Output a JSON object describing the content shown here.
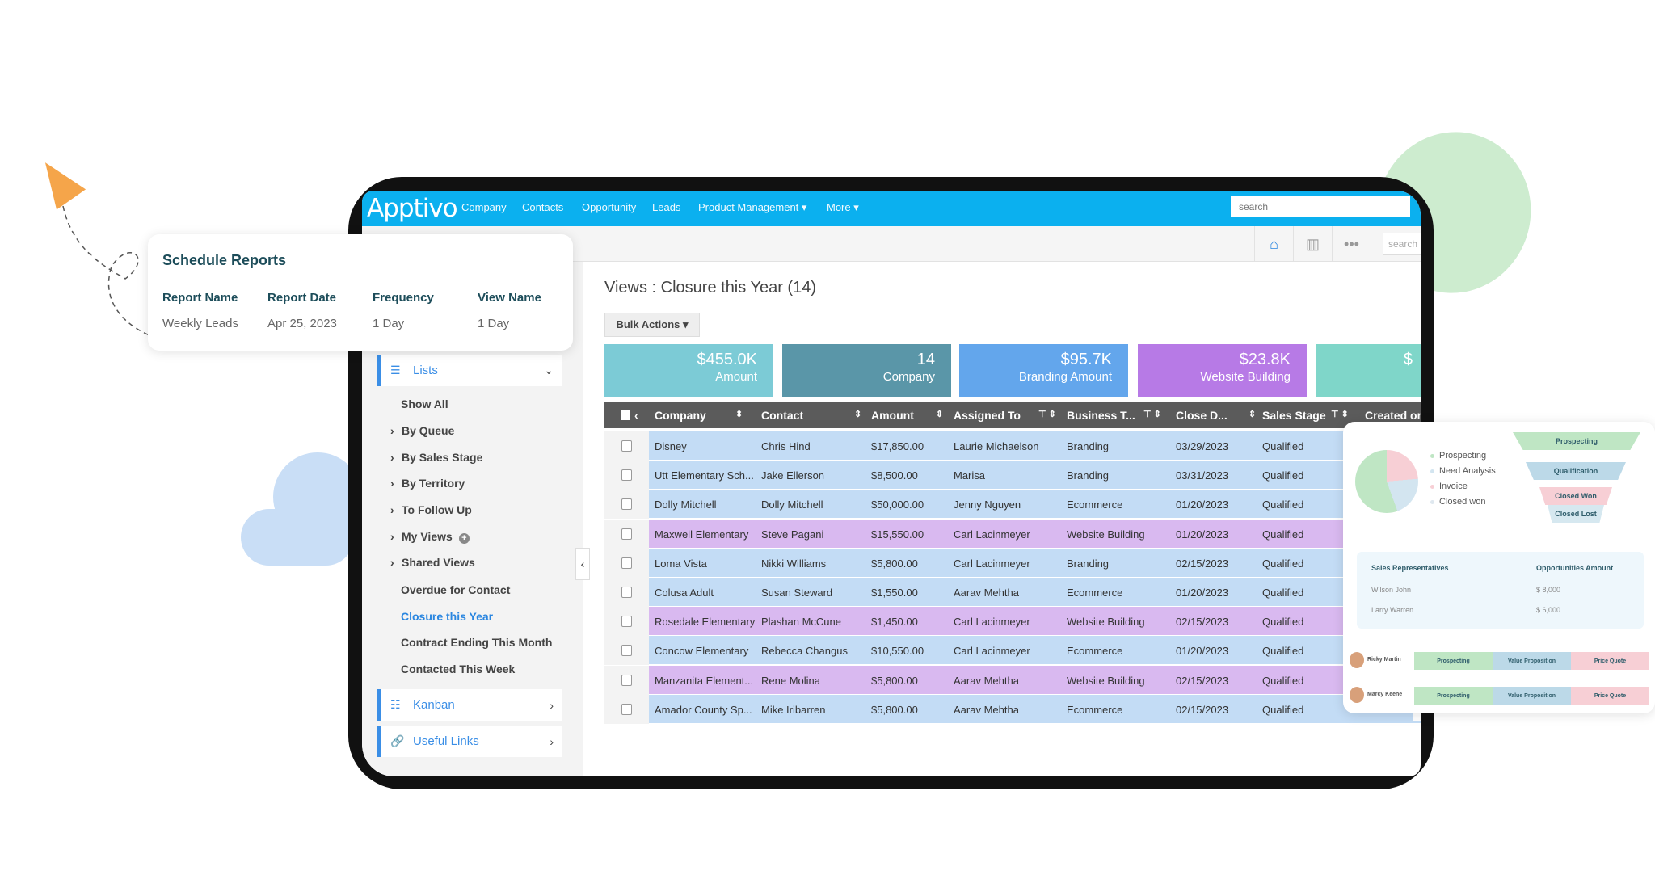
{
  "app": {
    "logo": "Apptivo",
    "nav": [
      "Company",
      "Contacts",
      "Opportunity",
      "Leads",
      "Product Management ▾",
      "More ▾"
    ],
    "search_placeholder": "search",
    "toolbar_search_placeholder": "search",
    "toolbar_icons": [
      "home-icon",
      "bar-chart-icon",
      "more-dots-icon"
    ],
    "brand_color": "#0bb0ef"
  },
  "schedule_reports": {
    "title": "Schedule Reports",
    "headers": [
      "Report Name",
      "Report Date",
      "Frequency",
      "View Name"
    ],
    "values": [
      "Weekly Leads",
      "Apr 25, 2023",
      "1 Day",
      "1 Day"
    ]
  },
  "sidebar": {
    "lists_label": "Lists",
    "items": [
      {
        "label": "Show All",
        "chevron": false
      },
      {
        "label": "By Queue",
        "chevron": true
      },
      {
        "label": "By Sales Stage",
        "chevron": true
      },
      {
        "label": "By Territory",
        "chevron": true
      },
      {
        "label": "To Follow Up",
        "chevron": true
      },
      {
        "label": "My Views",
        "chevron": true
      },
      {
        "label": "Shared Views",
        "chevron": true
      },
      {
        "label": "Overdue for Contact",
        "chevron": false
      },
      {
        "label": "Closure this Year",
        "chevron": false,
        "active": true
      },
      {
        "label": "Contract Ending This Month",
        "chevron": false
      },
      {
        "label": "Contacted This Week",
        "chevron": false
      }
    ],
    "kanban_label": "Kanban",
    "useful_links_label": "Useful Links"
  },
  "main": {
    "title": "Views : Closure this Year (14)",
    "bulk_actions": "Bulk Actions ▾",
    "kpis": [
      {
        "value": "$455.0K",
        "label": "Amount",
        "color": "#7ccbd6"
      },
      {
        "value": "14",
        "label": "Company",
        "color": "#5a96a8"
      },
      {
        "value": "$95.7K",
        "label": "Branding Amount",
        "color": "#63a6ec"
      },
      {
        "value": "$23.8K",
        "label": "Website Building",
        "color": "#b77ae6"
      },
      {
        "value": "$",
        "label": "",
        "color": "#7fd6c9"
      }
    ],
    "columns": [
      "Company",
      "Contact",
      "Amount",
      "Assigned To",
      "Business T...",
      "Close D...",
      "Sales Stage",
      "Created on"
    ],
    "rows": [
      [
        "Disney",
        "Chris Hind",
        "$17,850.00",
        "Laurie Michaelson",
        "Branding",
        "03/29/2023",
        "Qualified"
      ],
      [
        "Utt Elementary Sch...",
        "Jake Ellerson",
        "$8,500.00",
        "Marisa",
        "Branding",
        "03/31/2023",
        "Qualified"
      ],
      [
        "Dolly Mitchell",
        "Dolly Mitchell",
        "$50,000.00",
        "Jenny Nguyen",
        "Ecommerce",
        "01/20/2023",
        "Qualified"
      ],
      [
        "Maxwell Elementary",
        "Steve Pagani",
        "$15,550.00",
        "Carl Lacinmeyer",
        "Website Building",
        "01/20/2023",
        "Qualified"
      ],
      [
        "Loma Vista",
        "Nikki Williams",
        "$5,800.00",
        "Carl Lacinmeyer",
        "Branding",
        "02/15/2023",
        "Qualified"
      ],
      [
        "Colusa Adult",
        "Susan Steward",
        "$1,550.00",
        "Aarav Mehtha",
        "Ecommerce",
        "01/20/2023",
        "Qualified"
      ],
      [
        "Rosedale Elementary",
        "Plashan McCune",
        "$1,450.00",
        "Carl Lacinmeyer",
        "Website Building",
        "02/15/2023",
        "Qualified"
      ],
      [
        "Concow Elementary",
        "Rebecca Changus",
        "$10,550.00",
        "Carl Lacinmeyer",
        "Ecommerce",
        "01/20/2023",
        "Qualified"
      ],
      [
        "Manzanita Element...",
        "Rene Molina",
        "$5,800.00",
        "Aarav Mehtha",
        "Website Building",
        "02/15/2023",
        "Qualified"
      ],
      [
        "Amador County Sp...",
        "Mike Iribarren",
        "$5,800.00",
        "Aarav Mehtha",
        "Ecommerce",
        "02/15/2023",
        "Qualified"
      ]
    ],
    "row_colors": {
      "Branding": "#c3dcf5",
      "Ecommerce": "#c3dcf5",
      "Website Building": "#d9b9f0"
    }
  },
  "dashboard": {
    "legend": [
      {
        "label": "Prospecting",
        "color": "#bfe6c4"
      },
      {
        "label": "Need Analysis",
        "color": "#d3e5f0"
      },
      {
        "label": "Invoice",
        "color": "#f7cfd5"
      },
      {
        "label": "Closed won",
        "color": "#dfe8ef"
      }
    ],
    "funnel": [
      {
        "label": "Prospecting",
        "color": "#bfe6c4"
      },
      {
        "label": "Qualification",
        "color": "#bcd9e8"
      },
      {
        "label": "Closed Won",
        "color": "#f7cfd5"
      },
      {
        "label": "Closed Lost",
        "color": "#d6e8f0"
      }
    ],
    "reps_headers": [
      "Sales Representatives",
      "Opportunities Amount"
    ],
    "reps": [
      [
        "Wilson John",
        "$ 8,000"
      ],
      [
        "Larry Warren",
        "$ 6,000"
      ]
    ],
    "people": [
      {
        "name": "Ricky Martin",
        "stages": [
          "Prospecting",
          "Value Proposition",
          "Price Quote"
        ]
      },
      {
        "name": "Marcy Keene",
        "stages": [
          "Prospecting",
          "Value Proposition",
          "Price Quote"
        ]
      }
    ],
    "stage_colors": [
      "#bfe6c4",
      "#bcd9e8",
      "#f7cfd5"
    ]
  }
}
